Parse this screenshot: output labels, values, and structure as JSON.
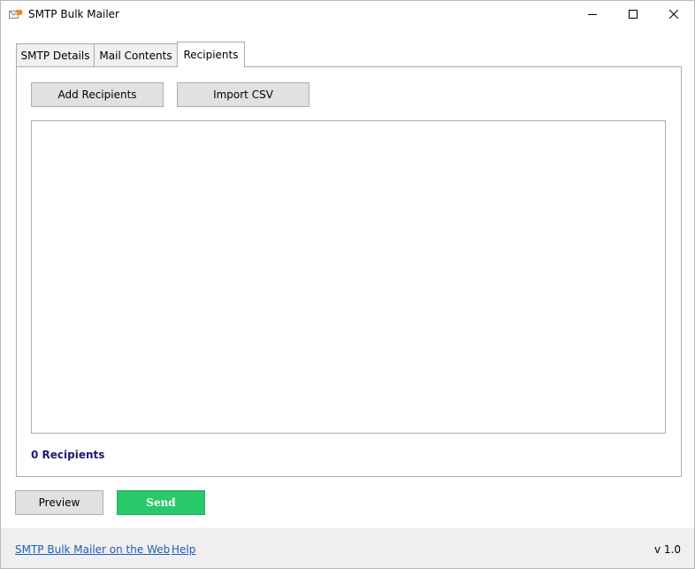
{
  "window": {
    "title": "SMTP Bulk Mailer",
    "icon": "mail-arrow-icon",
    "controls": [
      "minimize-icon",
      "maximize-icon",
      "close-icon"
    ]
  },
  "tabs": [
    {
      "label": "SMTP Details",
      "active": false
    },
    {
      "label": "Mail Contents",
      "active": false
    },
    {
      "label": "Recipients",
      "active": true
    }
  ],
  "recipients_panel": {
    "add_button": "Add Recipients",
    "import_button": "Import CSV",
    "items": [],
    "count_label": "0 Recipients"
  },
  "actions": {
    "preview_label": "Preview",
    "send_label": "Send",
    "send_color": "#27c96a"
  },
  "footer": {
    "web_link": "SMTP Bulk Mailer on the Web",
    "help_link": "Help",
    "version": "v 1.0"
  }
}
